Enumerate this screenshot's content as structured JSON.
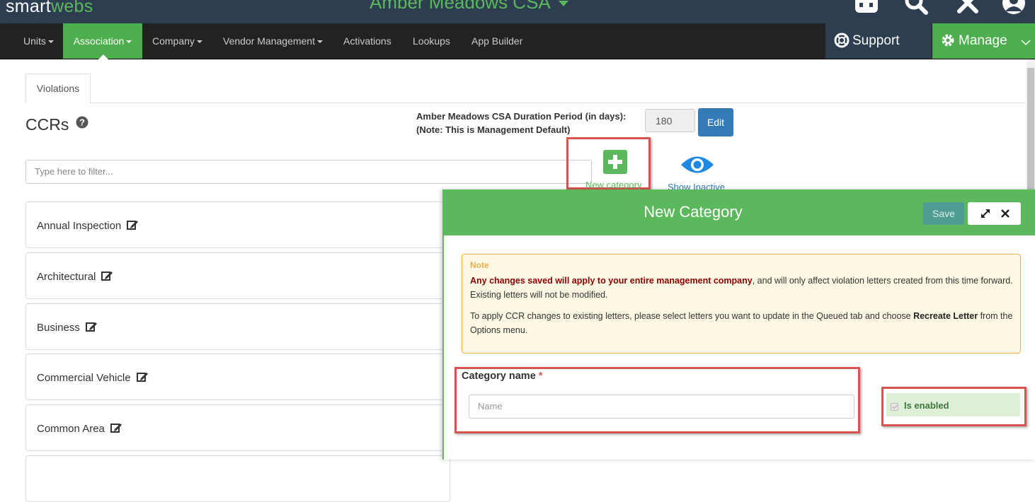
{
  "brand": {
    "part1": "smart",
    "part2": "webs"
  },
  "association_title": "Amber Meadows CSA",
  "top_icons": [
    "dashboard-icon",
    "search-icon",
    "tools-icon",
    "user-icon"
  ],
  "navbar": {
    "items": [
      {
        "label": "Units",
        "dropdown": true
      },
      {
        "label": "Association",
        "dropdown": true,
        "active": true
      },
      {
        "label": "Company",
        "dropdown": true
      },
      {
        "label": "Vendor Management",
        "dropdown": true
      },
      {
        "label": "Activations",
        "dropdown": false
      },
      {
        "label": "Lookups",
        "dropdown": false
      },
      {
        "label": "App Builder",
        "dropdown": false
      }
    ],
    "support_label": "Support",
    "manage_label": "Manage"
  },
  "tabs": [
    {
      "label": "Violations"
    }
  ],
  "page_title": "CCRs",
  "duration": {
    "line1": "Amber Meadows CSA Duration Period (in days):",
    "line2": "(Note: This is Management Default)",
    "value": "180",
    "edit_label": "Edit"
  },
  "filter": {
    "placeholder": "Type here to filter..."
  },
  "actions": {
    "new_category": "New category",
    "show_inactive": "Show Inactive"
  },
  "categories": [
    {
      "label": "Annual Inspection"
    },
    {
      "label": "Architectural"
    },
    {
      "label": "Business"
    },
    {
      "label": "Commercial Vehicle"
    },
    {
      "label": "Common Area"
    }
  ],
  "modal": {
    "title": "New Category",
    "save_label": "Save",
    "note": {
      "title": "Note",
      "p1_bold": "Any changes saved will apply to your entire management company",
      "p1_rest": ", and will only affect violation letters created from this time forward. Existing letters will not be modified.",
      "p2_start": "To apply CCR changes to existing letters, please select letters you want to update in the Queued tab and choose ",
      "p2_bold": "Recreate Letter",
      "p2_end": " from the Options menu."
    },
    "category_name_label": "Category name",
    "required_mark": "*",
    "name_placeholder": "Name",
    "is_enabled_label": "Is enabled",
    "is_enabled_checked": true
  },
  "colors": {
    "brand_green": "#5cb85c",
    "nav_dark": "#222222",
    "top_dark": "#2c3e50",
    "primary_blue": "#337ab7",
    "highlight_red": "#d9534f"
  }
}
